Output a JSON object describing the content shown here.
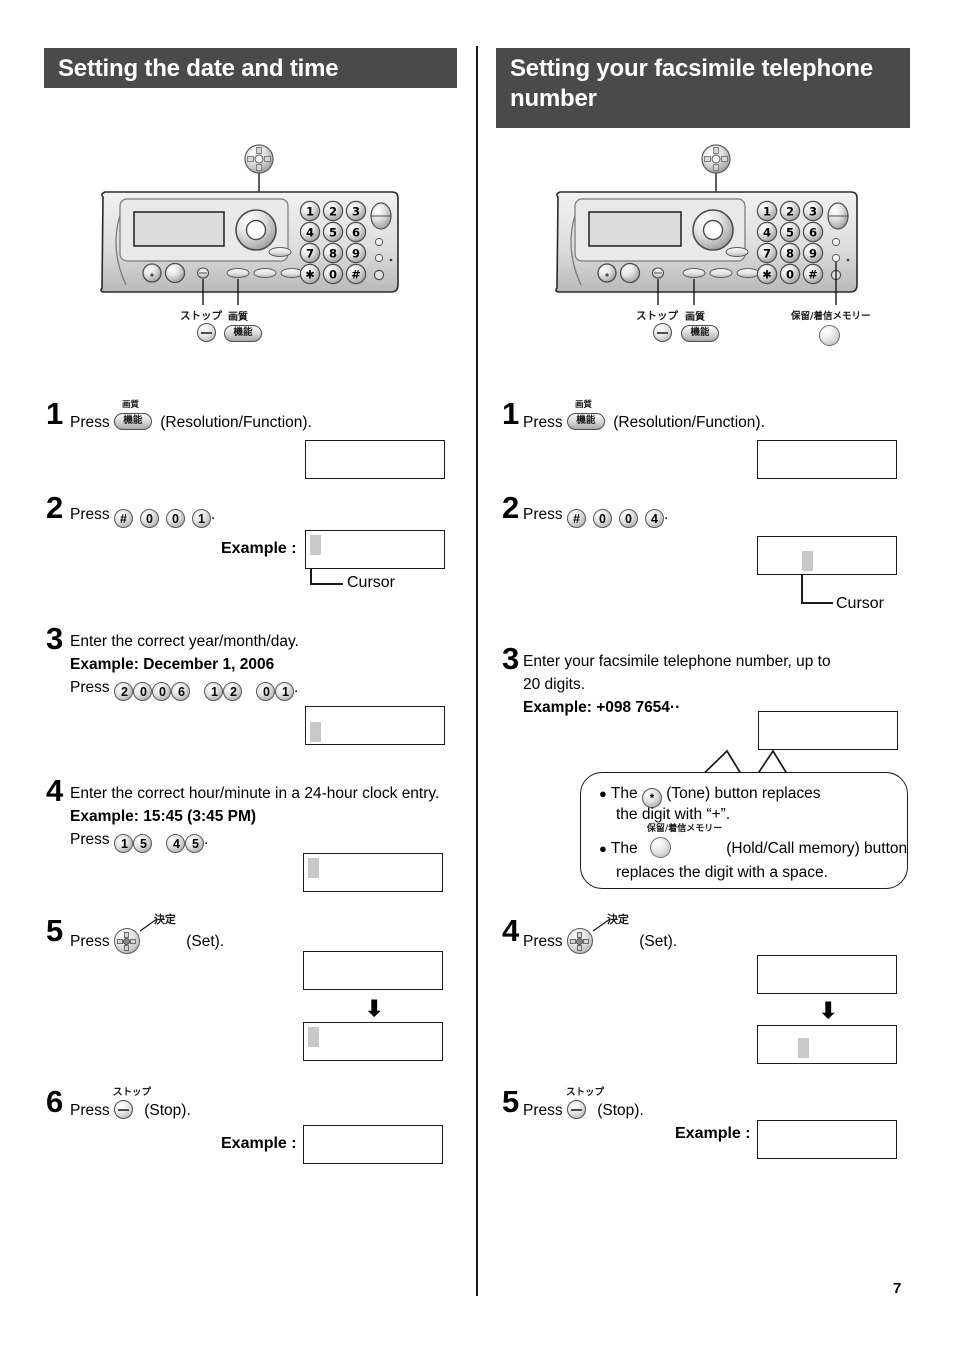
{
  "page": {
    "number": "7"
  },
  "left_section": {
    "header": "Setting the date and time",
    "diagram": {
      "label_stop": "ストップ",
      "label_quality": "画質",
      "label_function": "機能"
    },
    "steps": [
      {
        "num": "1",
        "press_label": "Press",
        "key_jp_top": "画質",
        "key_jp": "機能",
        "after": "(Resolution/Function)."
      },
      {
        "num": "2",
        "press_label": "Press",
        "keys": [
          "#",
          "0",
          "0",
          "1"
        ],
        "after": ".",
        "example_label": "Example :",
        "cursor_label": "Cursor"
      },
      {
        "num": "3",
        "line1": "Enter the correct year/month/day.",
        "line2": "Example: December 1, 2006",
        "press_label": "Press",
        "keys_g1": [
          "2",
          "0",
          "0",
          "6"
        ],
        "keys_g2": [
          "1",
          "2"
        ],
        "keys_g3": [
          "0",
          "1"
        ],
        "after": "."
      },
      {
        "num": "4",
        "line1": "Enter the correct hour/minute in a 24-hour clock entry.",
        "line2": "Example: 15:45 (3:45 PM)",
        "press_label": "Press",
        "keys_g1": [
          "1",
          "5"
        ],
        "keys_g2": [
          "4",
          "5"
        ],
        "after": "."
      },
      {
        "num": "5",
        "press_label": "Press",
        "key_jp": "決定",
        "after": "(Set)."
      },
      {
        "num": "6",
        "press_label": "Press",
        "key_jp": "ストップ",
        "after": "(Stop).",
        "example_label": "Example :"
      }
    ]
  },
  "right_section": {
    "header": "Setting your facsimile telephone number",
    "diagram": {
      "label_stop": "ストップ",
      "label_quality": "画質",
      "label_function": "機能",
      "label_hold": "保留/着信メモリー"
    },
    "steps": [
      {
        "num": "1",
        "press_label": "Press",
        "key_jp_top": "画質",
        "key_jp": "機能",
        "after": "(Resolution/Function)."
      },
      {
        "num": "2",
        "press_label": "Press",
        "keys": [
          "#",
          "0",
          "0",
          "4"
        ],
        "after": ".",
        "cursor_label": "Cursor"
      },
      {
        "num": "3",
        "line1": "Enter your facsimile telephone number, up to",
        "line2": "20 digits.",
        "line3": "Example: +098 7654··"
      },
      {
        "num": "4",
        "press_label": "Press",
        "key_jp": "決定",
        "after": "(Set)."
      },
      {
        "num": "5",
        "press_label": "Press",
        "key_jp": "ストップ",
        "after": "(Stop).",
        "example_label": "Example :"
      }
    ],
    "callout": {
      "bullet1_pre": "The",
      "bullet1_key": "*",
      "bullet1_mid": "(Tone) button replaces",
      "bullet1_line2": "the digit with “+”.",
      "bullet2_pre": "The",
      "bullet2_key_jp": "保留/着信メモリー",
      "bullet2_mid": "(Hold/Call memory) button",
      "bullet2_line2": "replaces the digit with a space."
    }
  },
  "colors": {
    "header_bg": "#4a4a4a",
    "header_text": "#ffffff",
    "ink": "#1a1a1a",
    "cursor": "#c9c9c9"
  }
}
